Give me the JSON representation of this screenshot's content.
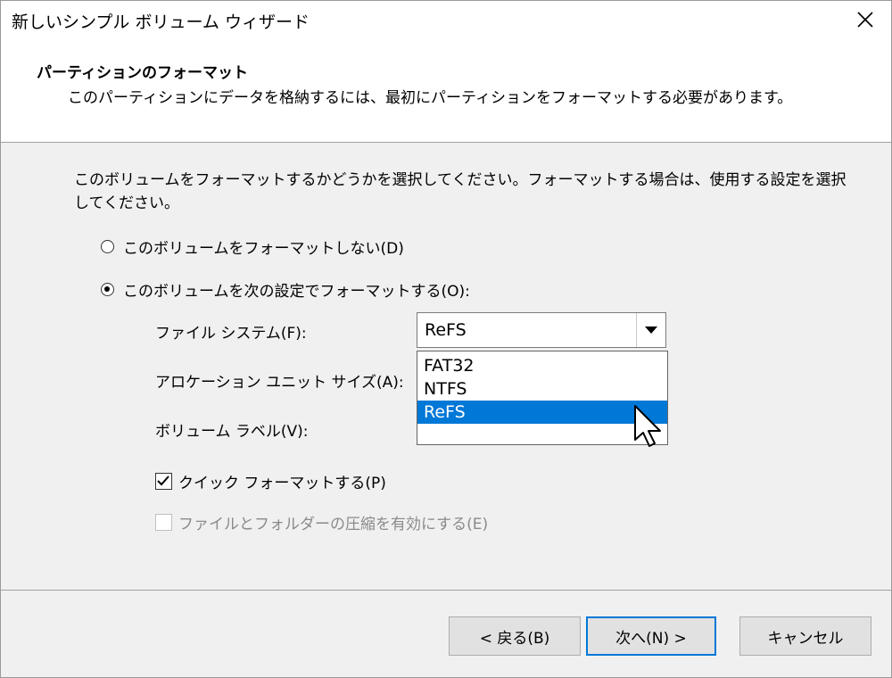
{
  "window": {
    "title": "新しいシンプル ボリューム ウィザード"
  },
  "header": {
    "title": "パーティションのフォーマット",
    "subtitle": "このパーティションにデータを格納するには、最初にパーティションをフォーマットする必要があります。"
  },
  "body": {
    "description": "このボリュームをフォーマットするかどうかを選択してください。フォーマットする場合は、使用する設定を選択してください。",
    "radio_no_format": {
      "label": "このボリュームをフォーマットしない(D)",
      "checked": false
    },
    "radio_format": {
      "label": "このボリュームを次の設定でフォーマットする(O):",
      "checked": true
    },
    "file_system": {
      "label": "ファイル システム(F):",
      "value": "ReFS",
      "options": [
        "FAT32",
        "NTFS",
        "ReFS"
      ],
      "highlighted": "ReFS"
    },
    "allocation_unit_label": "アロケーション ユニット サイズ(A):",
    "volume_label_label": "ボリューム ラベル(V):",
    "quick_format": {
      "label": "クイック フォーマットする(P)",
      "checked": true
    },
    "compression": {
      "label": "ファイルとフォルダーの圧縮を有効にする(E)",
      "checked": false,
      "disabled": true
    }
  },
  "footer": {
    "back_label": "< 戻る(B)",
    "next_label": "次へ(N) >",
    "cancel_label": "キャンセル"
  },
  "colors": {
    "accent": "#0078d7",
    "button_bg": "#e1e1e1",
    "panel_bg": "#f0f0f0"
  }
}
